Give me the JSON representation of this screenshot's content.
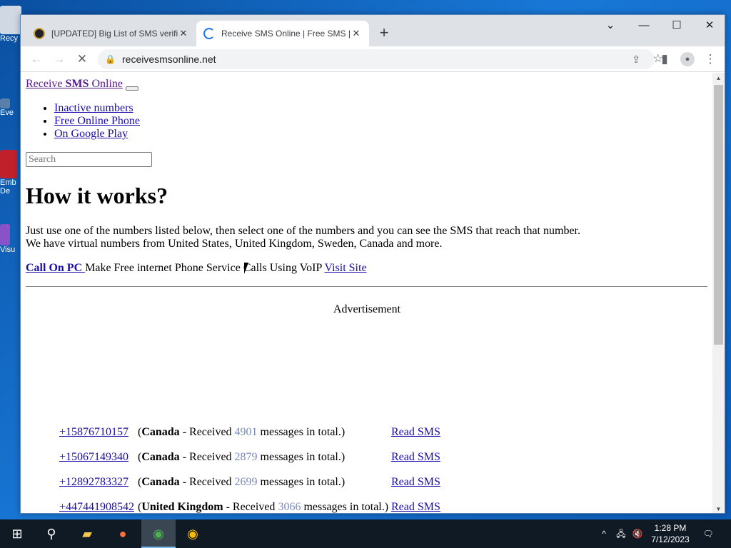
{
  "browser": {
    "tabs": [
      {
        "title": "[UPDATED] Big List of SMS verific",
        "active": false
      },
      {
        "title": "Receive SMS Online | Free SMS |",
        "active": true
      }
    ],
    "address": "receivesmsonline.net"
  },
  "site": {
    "brand_prefix": "Receive ",
    "brand_bold": "SMS",
    "brand_suffix": " Online",
    "nav": [
      "Inactive numbers",
      "Free Online Phone",
      "On Google Play"
    ],
    "search_placeholder": "Search",
    "heading": "How it works?",
    "intro_line1": "Just use one of the numbers listed below, then select one of the numbers and you can see the SMS that reach that number.",
    "intro_line2": "We have virtual numbers from United States, United Kingdom, Sweden, Canada and more.",
    "call_label": "Call On PC ",
    "call_text": "Make Free internet Phone Service Calls Using VoIP ",
    "visit_label": "Visit Site",
    "ad_label": "Advertisement",
    "numbers": [
      {
        "phone": "+15876710157",
        "country": "Canada",
        "count": "4901"
      },
      {
        "phone": "+15067149340",
        "country": "Canada",
        "count": "2879"
      },
      {
        "phone": "+12892783327",
        "country": "Canada",
        "count": "2699"
      },
      {
        "phone": "+447441908542",
        "country": "United Kingdom",
        "count": "3066"
      }
    ],
    "received_text": " - Received ",
    "messages_text": " messages in total.)",
    "read_label": "Read SMS"
  },
  "taskbar": {
    "time": "1:28 PM",
    "date": "7/12/2023"
  },
  "desktop_labels": [
    "Recy",
    "Eve",
    "Emb De",
    "Visu"
  ]
}
